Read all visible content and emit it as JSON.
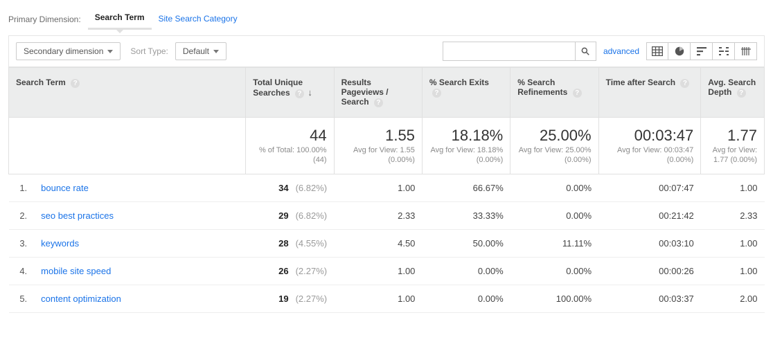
{
  "primary_dimension": {
    "label": "Primary Dimension:",
    "active": "Search Term",
    "other": "Site Search Category"
  },
  "controls": {
    "secondary_dimension": "Secondary dimension",
    "sort_type_label": "Sort Type:",
    "sort_type_value": "Default",
    "advanced": "advanced",
    "search_placeholder": ""
  },
  "columns": {
    "term": "Search Term",
    "unique": "Total Unique Searches",
    "pageviews": "Results Pageviews / Search",
    "exits": "% Search Exits",
    "refinements": "% Search Refinements",
    "time_after": "Time after Search",
    "depth": "Avg. Search Depth"
  },
  "summary": {
    "unique": {
      "big": "44",
      "sub": "% of Total: 100.00% (44)"
    },
    "pageviews": {
      "big": "1.55",
      "sub": "Avg for View: 1.55 (0.00%)"
    },
    "exits": {
      "big": "18.18%",
      "sub": "Avg for View: 18.18% (0.00%)"
    },
    "refinements": {
      "big": "25.00%",
      "sub": "Avg for View: 25.00% (0.00%)"
    },
    "time_after": {
      "big": "00:03:47",
      "sub": "Avg for View: 00:03:47 (0.00%)"
    },
    "depth": {
      "big": "1.77",
      "sub": "Avg for View: 1.77 (0.00%)"
    }
  },
  "rows": [
    {
      "rank": "1.",
      "term": "bounce rate",
      "unique": "34",
      "unique_pct": "(6.82%)",
      "pageviews": "1.00",
      "exits": "66.67%",
      "refinements": "0.00%",
      "time_after": "00:07:47",
      "depth": "1.00"
    },
    {
      "rank": "2.",
      "term": "seo best practices",
      "unique": "29",
      "unique_pct": "(6.82%)",
      "pageviews": "2.33",
      "exits": "33.33%",
      "refinements": "0.00%",
      "time_after": "00:21:42",
      "depth": "2.33"
    },
    {
      "rank": "3.",
      "term": "keywords",
      "unique": "28",
      "unique_pct": "(4.55%)",
      "pageviews": "4.50",
      "exits": "50.00%",
      "refinements": "11.11%",
      "time_after": "00:03:10",
      "depth": "1.00"
    },
    {
      "rank": "4.",
      "term": "mobile site speed",
      "unique": "26",
      "unique_pct": "(2.27%)",
      "pageviews": "1.00",
      "exits": "0.00%",
      "refinements": "0.00%",
      "time_after": "00:00:26",
      "depth": "1.00"
    },
    {
      "rank": "5.",
      "term": "content optimization",
      "unique": "19",
      "unique_pct": "(2.27%)",
      "pageviews": "1.00",
      "exits": "0.00%",
      "refinements": "100.00%",
      "time_after": "00:03:37",
      "depth": "2.00"
    }
  ],
  "chart_data": {
    "type": "table",
    "title": "Site Search — Search Terms",
    "columns": [
      "Search Term",
      "Total Unique Searches",
      "Results Pageviews / Search",
      "% Search Exits",
      "% Search Refinements",
      "Time after Search",
      "Avg. Search Depth"
    ],
    "totals": {
      "Total Unique Searches": 44,
      "Results Pageviews / Search": 1.55,
      "% Search Exits": 18.18,
      "% Search Refinements": 25.0,
      "Time after Search": "00:03:47",
      "Avg. Search Depth": 1.77
    },
    "rows": [
      [
        "bounce rate",
        34,
        1.0,
        66.67,
        0.0,
        "00:07:47",
        1.0
      ],
      [
        "seo best practices",
        29,
        2.33,
        33.33,
        0.0,
        "00:21:42",
        2.33
      ],
      [
        "keywords",
        28,
        4.5,
        50.0,
        11.11,
        "00:03:10",
        1.0
      ],
      [
        "mobile site speed",
        26,
        1.0,
        0.0,
        0.0,
        "00:00:26",
        1.0
      ],
      [
        "content optimization",
        19,
        1.0,
        0.0,
        100.0,
        "00:03:37",
        2.0
      ]
    ]
  }
}
